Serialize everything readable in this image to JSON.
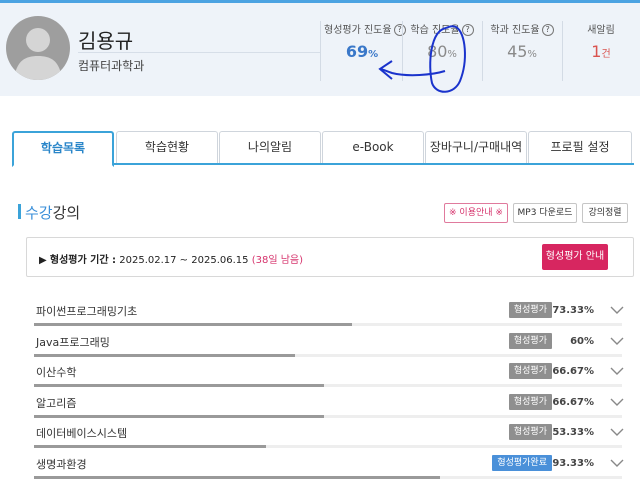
{
  "profile": {
    "name": "김용규",
    "department": "컴퓨터과학과",
    "avatar_icon": "user-avatar-icon"
  },
  "stats": [
    {
      "label": "형성평가 진도율",
      "value": "69",
      "unit": "%",
      "help": "?"
    },
    {
      "label": "학습 진도율",
      "value": "80",
      "unit": "%",
      "help": "?"
    },
    {
      "label": "학과 진도율",
      "value": "45",
      "unit": "%",
      "help": "?"
    },
    {
      "label": "새알림",
      "value": "1",
      "unit": "건"
    }
  ],
  "tabs": [
    "학습목록",
    "학습현황",
    "나의알림",
    "e-Book",
    "장바구니/구매내역",
    "프로필 설정"
  ],
  "section": {
    "title_highlight": "수강",
    "title_rest": "강의",
    "buttons": [
      "※ 이용안내 ※",
      "MP3 다운로드",
      "강의정렬"
    ]
  },
  "period": {
    "bullet": "▶",
    "label": "형성평가 기간 :",
    "range": "2025.02.17 ~ 2025.06.15",
    "remaining": "(38일 남음)",
    "button": "형성평가 안내"
  },
  "courses": [
    {
      "name": "파이썬프로그래밍기초",
      "badge": "형성평가",
      "percent": "73.33%",
      "progress": 0.73,
      "completed": false
    },
    {
      "name": "Java프로그래밍",
      "badge": "형성평가",
      "percent": "60%",
      "progress": 0.6,
      "completed": false
    },
    {
      "name": "이산수학",
      "badge": "형성평가",
      "percent": "66.67%",
      "progress": 0.667,
      "completed": false
    },
    {
      "name": "알고리즘",
      "badge": "형성평가",
      "percent": "66.67%",
      "progress": 0.667,
      "completed": false
    },
    {
      "name": "데이터베이스시스템",
      "badge": "형성평가",
      "percent": "53.33%",
      "progress": 0.533,
      "completed": false
    },
    {
      "name": "생명과환경",
      "badge": "형성평가완료",
      "percent": "93.33%",
      "progress": 0.933,
      "completed": true
    }
  ],
  "colors": {
    "accent": "#3ba3d9",
    "highlight_value": "#3a78c9",
    "notification": "#d9534f",
    "primary_button": "#d72660",
    "badge_gray": "#8f8f8f",
    "badge_done": "#4a90d9",
    "annotation_ink": "#1a33cc"
  },
  "icons": [
    "user-avatar-icon",
    "help-circle-icon",
    "chevron-down-icon",
    "play-bullet-icon"
  ]
}
